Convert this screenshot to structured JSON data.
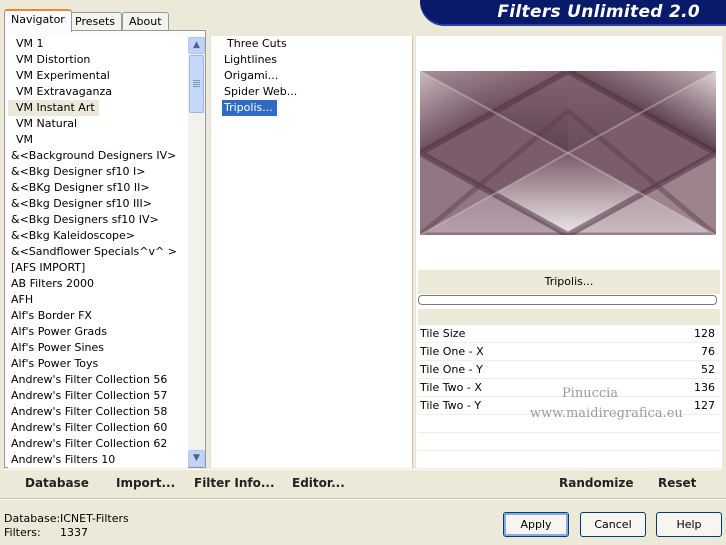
{
  "app": {
    "title": "Filters Unlimited 2.0"
  },
  "tabs": [
    {
      "label": "Navigator",
      "active": true
    },
    {
      "label": "Presets",
      "active": false
    },
    {
      "label": "About",
      "active": false
    }
  ],
  "categories": {
    "selected": "VM Instant Art",
    "items": [
      "VM 1",
      "VM Distortion",
      "VM Experimental",
      "VM Extravaganza",
      "VM Instant Art",
      "VM Natural",
      "VM",
      "&<Background Designers IV>",
      "&<Bkg Designer sf10 I>",
      "&<BKg Designer sf10 II>",
      "&<Bkg Designer sf10 III>",
      "&<Bkg Designers sf10 IV>",
      "&<Bkg Kaleidoscope>",
      "&<Sandflower Specials^v^ >",
      "[AFS IMPORT]",
      "AB Filters 2000",
      "AFH",
      "Alf's Border FX",
      "Alf's Power Grads",
      "Alf's Power Sines",
      "Alf's Power Toys",
      "Andrew's Filter Collection 56",
      "Andrew's Filter Collection 57",
      "Andrew's Filter Collection 58",
      "Andrew's Filter Collection 60",
      "Andrew's Filter Collection 62",
      "Andrew's Filters 10"
    ]
  },
  "filters": {
    "selected": "Tripolis...",
    "items": [
      "Three Cuts",
      "Lightlines",
      "Origami...",
      "Spider Web...",
      "Tripolis..."
    ]
  },
  "preview": {
    "filter_name": "Tripolis...",
    "progress": 0
  },
  "params": [
    {
      "label": "Tile Size",
      "value": "128"
    },
    {
      "label": "Tile One - X",
      "value": "76"
    },
    {
      "label": "Tile One - Y",
      "value": "52"
    },
    {
      "label": "Tile Two - X",
      "value": "136"
    },
    {
      "label": "Tile Two - Y",
      "value": "127"
    }
  ],
  "watermark": {
    "line1": "Pinuccia",
    "line2": "www.maidiregrafica.eu"
  },
  "toolbar": {
    "database": "Database",
    "import": "Import...",
    "filter_info": "Filter Info...",
    "editor": "Editor...",
    "randomize": "Randomize",
    "reset": "Reset"
  },
  "status": {
    "database_label": "Database:",
    "database_value": "ICNET-Filters",
    "filters_label": "Filters:",
    "filters_value": "1337"
  },
  "buttons": {
    "apply": "Apply",
    "cancel": "Cancel",
    "help": "Help"
  },
  "colors": {
    "selection": "#316ac5",
    "banner": "#0a1a6a",
    "preview_base": "#6e4f5e"
  }
}
